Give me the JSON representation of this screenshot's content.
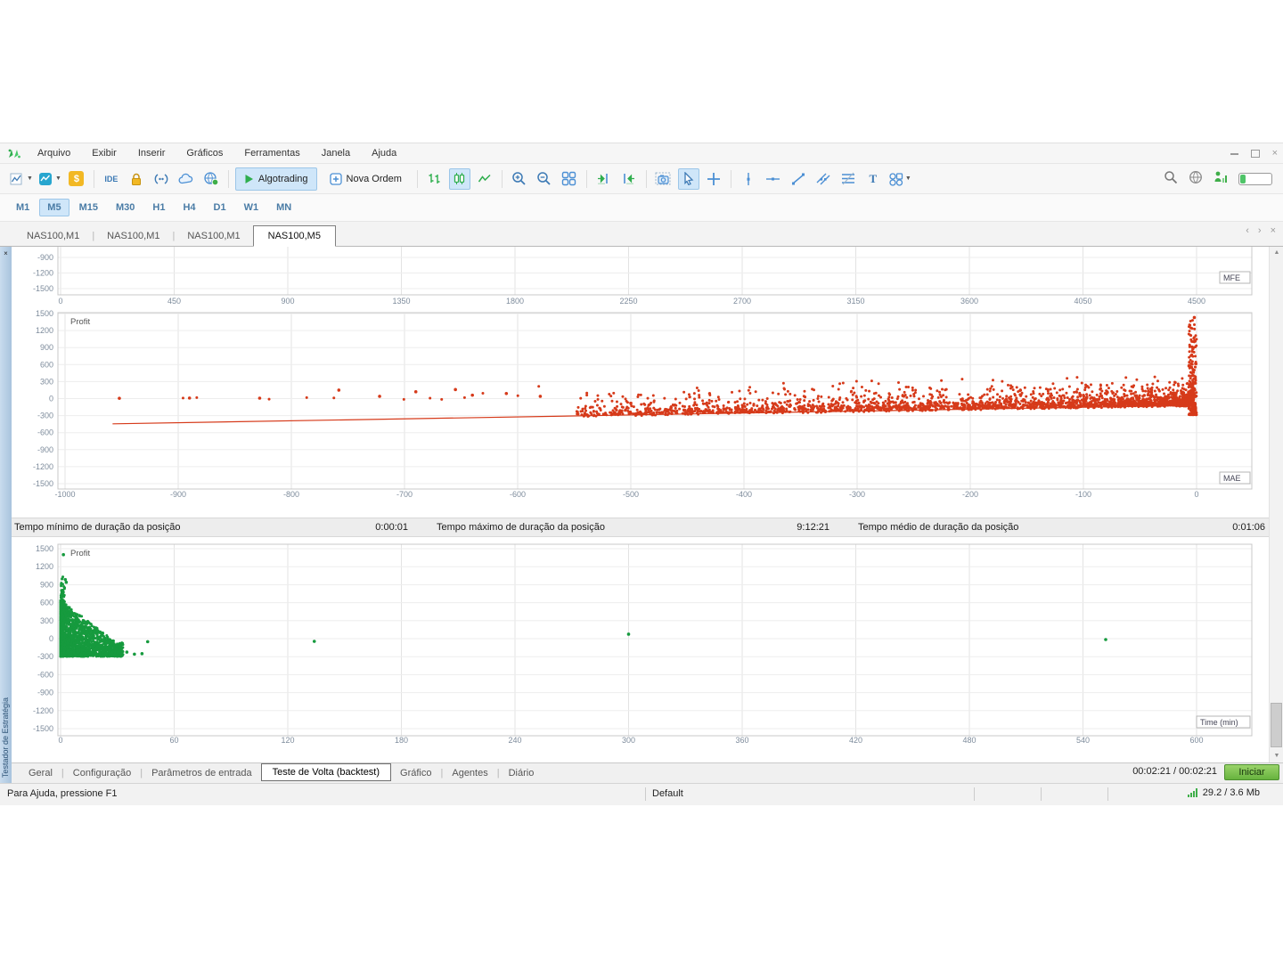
{
  "menu": {
    "items": [
      "Arquivo",
      "Exibir",
      "Inserir",
      "Gráficos",
      "Ferramentas",
      "Janela",
      "Ajuda"
    ]
  },
  "toolbar": {
    "algotrading": "Algotrading",
    "nova_ordem": "Nova Ordem",
    "ide_label": "IDE",
    "market_watch_label": "$",
    "text_tool_label": "T",
    "accent_blue": "#3d7ab5",
    "accent_green": "#2fae4e",
    "selected_bg": "#cfe6f9"
  },
  "timeframes": {
    "items": [
      "M1",
      "M5",
      "M15",
      "M30",
      "H1",
      "H4",
      "D1",
      "W1",
      "MN"
    ],
    "selected": "M5"
  },
  "chart_tabs": {
    "items": [
      "NAS100,M1",
      "NAS100,M1",
      "NAS100,M1",
      "NAS100,M5"
    ],
    "active_index": 3
  },
  "tester": {
    "panel_title": "Testador de Estratégia",
    "stats": [
      {
        "label": "Tempo mínimo de duração da posição",
        "value": "0:00:01"
      },
      {
        "label": "Tempo máximo de duração da posição",
        "value": "9:12:21"
      },
      {
        "label": "Tempo médio de duração da posição",
        "value": "0:01:06"
      }
    ],
    "progress": "00:02:21 / 00:02:21",
    "start_label": "Iniciar"
  },
  "bottom_tabs": {
    "items": [
      "Geral",
      "Configuração",
      "Parâmetros de entrada",
      "Teste de Volta (backtest)",
      "Gráfico",
      "Agentes",
      "Diário"
    ],
    "active": "Teste de Volta (backtest)"
  },
  "status_bar": {
    "help": "Para Ajuda, pressione F1",
    "profile": "Default",
    "traffic": "29.2 / 3.6 Mb"
  },
  "chart_data": [
    {
      "id": "mfe",
      "type": "scatter",
      "corner_label": "MFE",
      "x_ticks": [
        0,
        450,
        900,
        1350,
        1800,
        2250,
        2700,
        3150,
        3600,
        4050,
        4500
      ],
      "y_ticks_visible": [
        -900,
        -1200,
        -1500
      ],
      "xlim": [
        0,
        4500
      ],
      "ylim": [
        -1500,
        1500
      ],
      "point_color": "#d63a1a",
      "clusters": [],
      "points": []
    },
    {
      "id": "mae",
      "type": "scatter",
      "series_label": "Profit",
      "corner_label": "MAE",
      "x_ticks": [
        -1000,
        -900,
        -800,
        -700,
        -600,
        -500,
        -400,
        -300,
        -200,
        -100,
        0
      ],
      "y_ticks": [
        1500,
        1200,
        900,
        600,
        300,
        0,
        -300,
        -600,
        -900,
        -1200,
        -1500
      ],
      "xlim": [
        -1000,
        0
      ],
      "ylim": [
        -1500,
        1500
      ],
      "point_color": "#d63a1a",
      "trend": {
        "x0": -958,
        "y0": -445,
        "x1": 0,
        "y1": -118,
        "color": "#d63a1a"
      },
      "clusters": [
        {
          "gen": "band",
          "n": 2600,
          "seed": 11,
          "x_pow": 2.1,
          "x_scale": 545,
          "x_off": 3,
          "gap_min": 5,
          "gap_mean": 95,
          "gap_max": 420,
          "below_frac": 0.05,
          "below_max": 14
        },
        {
          "gen": "upper",
          "n": 70,
          "seed": 12,
          "x_pow": 1.5,
          "x_scale": 680,
          "base": 300,
          "range": 240
        },
        {
          "gen": "spike",
          "n": 210,
          "seed": 13,
          "width": 7,
          "y0": -285,
          "range": 1720,
          "pow": 2.6
        },
        {
          "gen": "sparse",
          "n": 8,
          "seed": 14,
          "x0": -958,
          "x1": -575,
          "y0": -15,
          "y1": 60
        }
      ],
      "points": [
        [
          -952,
          5
        ],
        [
          -890,
          10
        ],
        [
          -828,
          8
        ],
        [
          -758,
          150
        ],
        [
          -722,
          40
        ],
        [
          -690,
          120
        ],
        [
          -655,
          160
        ],
        [
          -640,
          60
        ],
        [
          -610,
          90
        ],
        [
          -580,
          40
        ],
        [
          -2,
          1430
        ]
      ]
    },
    {
      "id": "time",
      "type": "scatter",
      "series_label": "Profit",
      "corner_label": "Time (min)",
      "x_ticks": [
        0,
        60,
        120,
        180,
        240,
        300,
        360,
        420,
        480,
        540,
        600
      ],
      "y_ticks": [
        1500,
        1200,
        900,
        600,
        300,
        0,
        -300,
        -600,
        -900,
        -1200,
        -1500
      ],
      "xlim": [
        0,
        600
      ],
      "ylim": [
        -1500,
        1500
      ],
      "point_color": "#169a3e",
      "clusters": [
        {
          "gen": "tri",
          "n": 1900,
          "seed": 21,
          "x_max": 33,
          "x_pow": 2.6,
          "top0": 640,
          "slope": 24,
          "top_min": -60,
          "y_min": -297,
          "y_pow": 1.3
        },
        {
          "gen": "col",
          "n": 240,
          "seed": 22,
          "width": 2.2,
          "y0": -290,
          "range": 1330,
          "pow": 2.3
        }
      ],
      "points": [
        [
          1.5,
          1400
        ],
        [
          2.5,
          985
        ],
        [
          3,
          940
        ],
        [
          46,
          -50
        ],
        [
          134,
          -45
        ],
        [
          300,
          75
        ],
        [
          552,
          -15
        ],
        [
          21,
          -253
        ],
        [
          24,
          -246
        ],
        [
          27,
          -238
        ],
        [
          31,
          -230
        ],
        [
          35,
          -224
        ],
        [
          39,
          -258
        ],
        [
          43,
          -250
        ],
        [
          29,
          -172
        ]
      ]
    }
  ]
}
